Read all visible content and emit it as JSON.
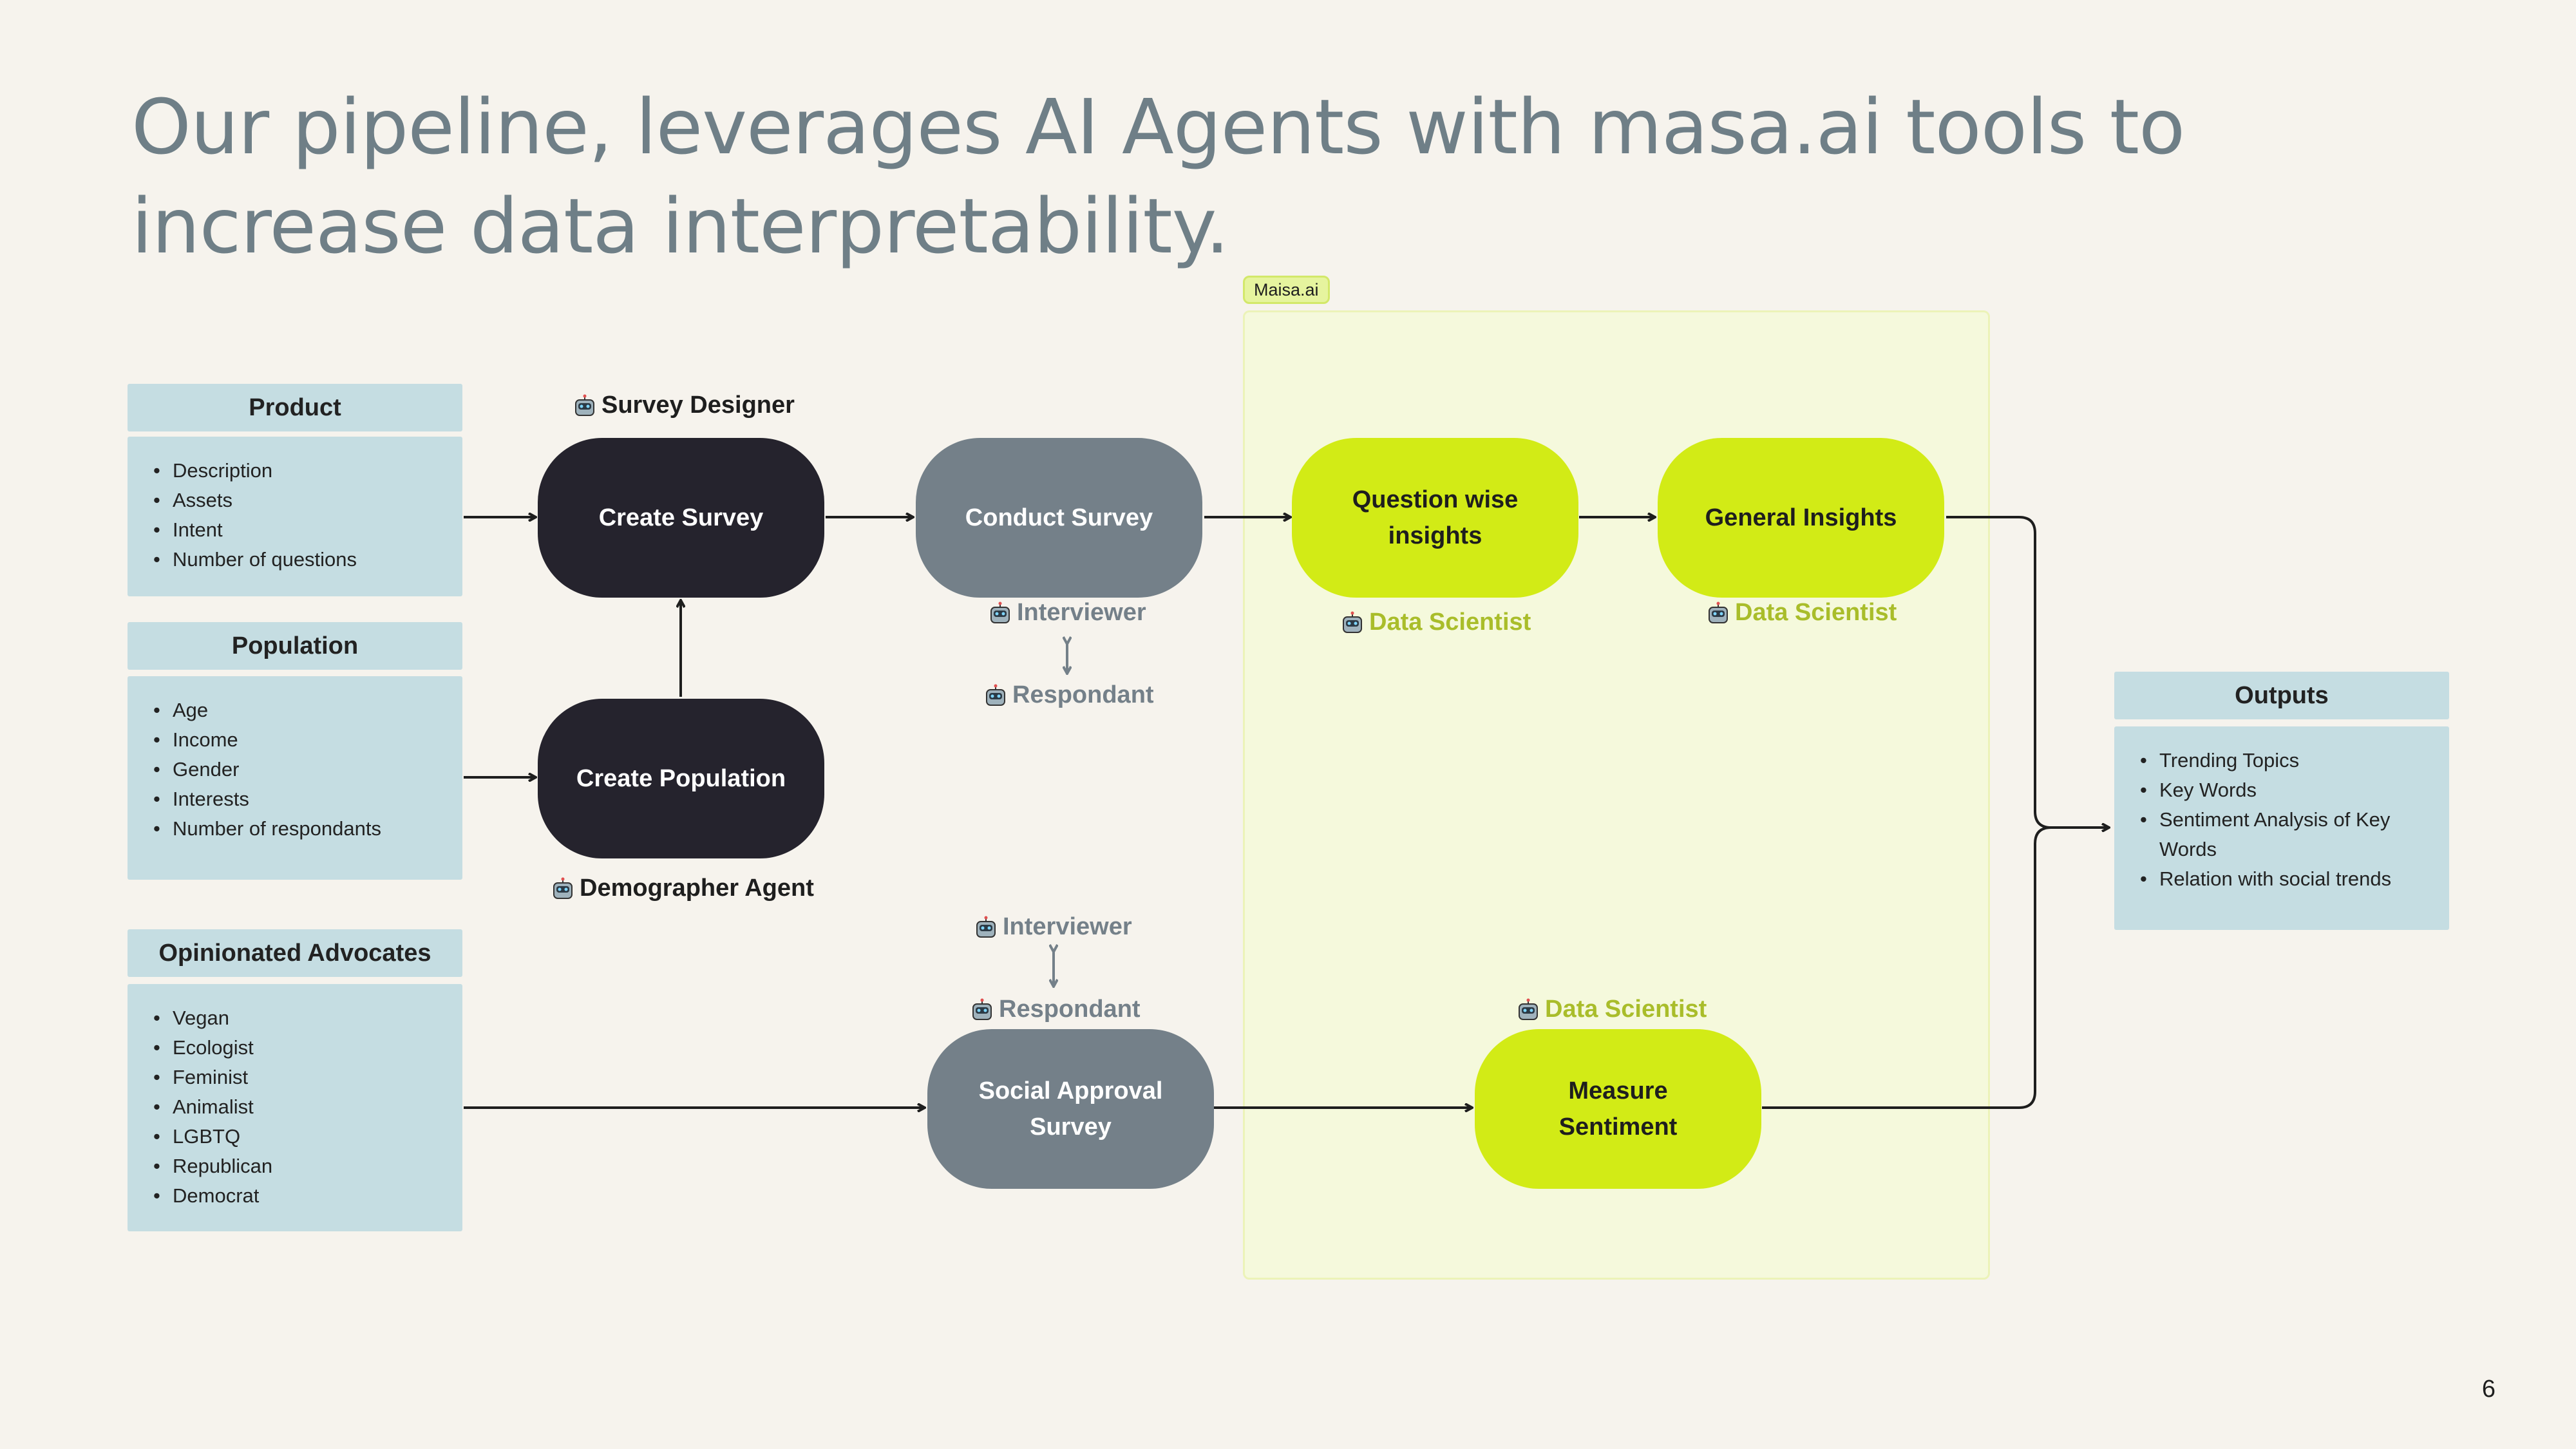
{
  "title": "Our pipeline, leverages AI Agents with masa.ai tools to increase data interpretability.",
  "page_number": "6",
  "maisa_tag": "Maisa.ai",
  "inputs": {
    "product": {
      "header": "Product",
      "items": [
        "Description",
        "Assets",
        "Intent",
        "Number of questions"
      ]
    },
    "population": {
      "header": "Population",
      "items": [
        "Age",
        "Income",
        "Gender",
        "Interests",
        "Number of respondants"
      ]
    },
    "advocates": {
      "header": "Opinionated Advocates",
      "items": [
        "Vegan",
        "Ecologist",
        "Feminist",
        "Animalist",
        "LGBTQ",
        "Republican",
        "Democrat"
      ]
    }
  },
  "outputs": {
    "header": "Outputs",
    "items": [
      "Trending Topics",
      "Key Words",
      "Sentiment Analysis of Key Words",
      "Relation with social trends"
    ]
  },
  "nodes": {
    "create_survey": "Create Survey",
    "create_population": "Create Population",
    "conduct_survey": "Conduct Survey",
    "social_approval_survey": "Social Approval Survey",
    "question_wise_insights": "Question wise insights",
    "general_insights": "General Insights",
    "measure_sentiment": "Measure Sentiment"
  },
  "agents": {
    "survey_designer": "Survey Designer",
    "demographer_agent": "Demographer Agent",
    "interviewer_top": "Interviewer",
    "respondant_top": "Respondant",
    "interviewer_bottom": "Interviewer",
    "respondant_bottom": "Respondant",
    "data_scientist_qwi": "Data Scientist",
    "data_scientist_gi": "Data Scientist",
    "data_scientist_ms": "Data Scientist"
  },
  "colors": {
    "background": "#f6f3ed",
    "title": "#6f7f87",
    "card": "#c5dde2",
    "dark_node": "#25232d",
    "grey_node": "#748089",
    "lime_node": "#d2eb16",
    "lime_text": "#a9bd2a",
    "maisa_region": "#f5f9dc"
  },
  "icons": {
    "agent": "robot-icon"
  }
}
